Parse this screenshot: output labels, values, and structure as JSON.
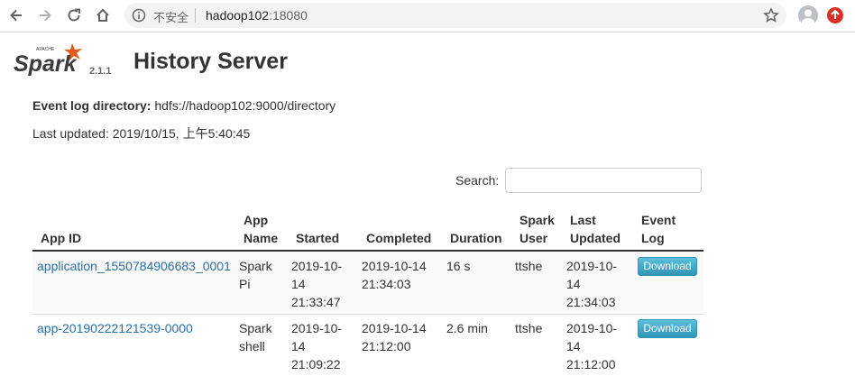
{
  "browser": {
    "security_label": "不安全",
    "url_host": "hadoop102",
    "url_port": ":18080"
  },
  "page": {
    "logo_small_text": "APACHE",
    "logo_text": "Spark",
    "version": "2.1.1",
    "title": "History Server",
    "event_log_label": "Event log directory:",
    "event_log_value": "hdfs://hadoop102:9000/directory",
    "last_updated": "Last updated: 2019/10/15, 上午5:40:45",
    "search_label": "Search:",
    "search_value": ""
  },
  "table": {
    "headers": {
      "app_id": "App ID",
      "app_name_1": "App",
      "app_name_2": "Name",
      "started": "Started",
      "completed": "Completed",
      "duration": "Duration",
      "spark_user_1": "Spark",
      "spark_user_2": "User",
      "last_updated_1": "Last",
      "last_updated_2": "Updated",
      "event_log_1": "Event",
      "event_log_2": "Log"
    },
    "rows": [
      {
        "app_id": "application_1550784906683_0001",
        "name_1": "Spark",
        "name_2": "Pi",
        "started_1": "2019-10-",
        "started_2": "14",
        "started_3": "21:33:47",
        "completed_1": "2019-10-14",
        "completed_2": "21:34:03",
        "duration": "16 s",
        "user": "ttshe",
        "updated_1": "2019-10-",
        "updated_2": "14",
        "updated_3": "21:34:03",
        "download": "Download"
      },
      {
        "app_id": "app-20190222121539-0000",
        "name_1": "Spark",
        "name_2": "shell",
        "started_1": "2019-10-",
        "started_2": "14",
        "started_3": "21:09:22",
        "completed_1": "2019-10-14",
        "completed_2": "21:12:00",
        "duration": "2.6 min",
        "user": "ttshe",
        "updated_1": "2019-10-",
        "updated_2": "14",
        "updated_3": "21:12:00",
        "download": "Download"
      }
    ]
  }
}
